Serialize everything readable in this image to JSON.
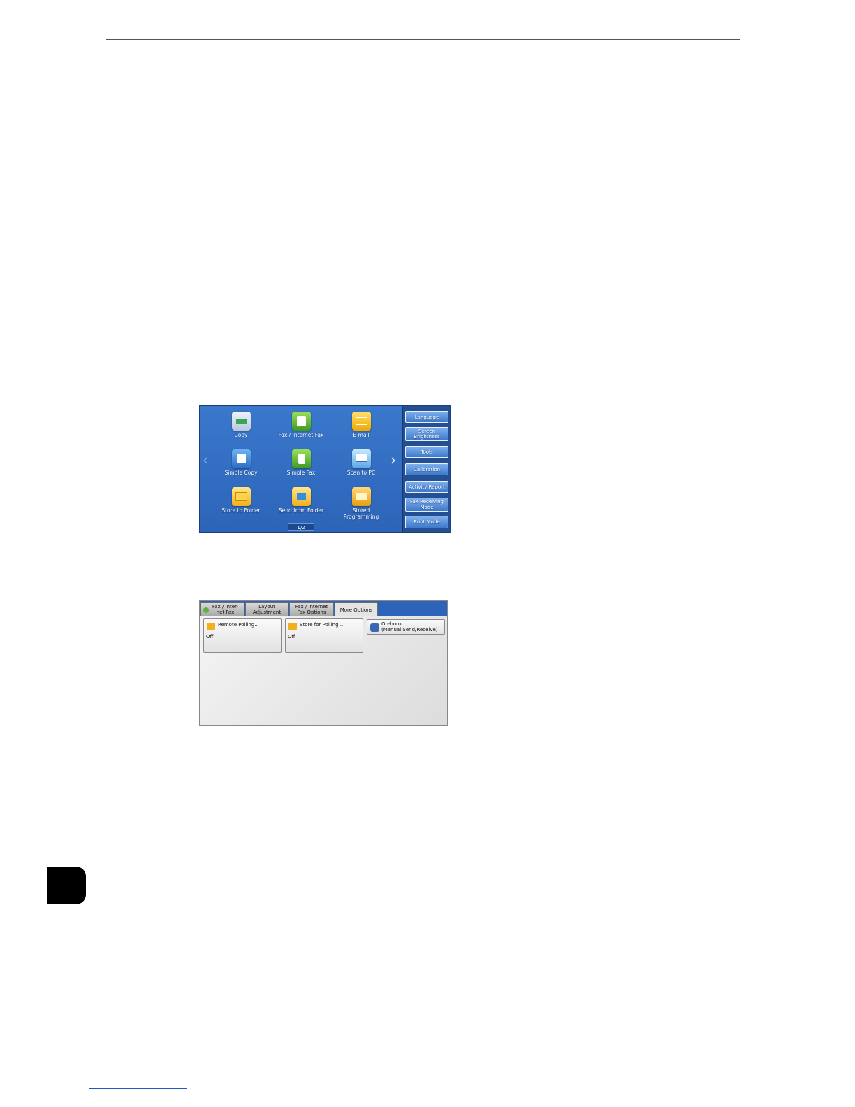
{
  "home": {
    "services": [
      {
        "label": "Copy",
        "icon": "copy-icon"
      },
      {
        "label": "Fax / Internet Fax",
        "icon": "fax-icon"
      },
      {
        "label": "E-mail",
        "icon": "email-icon"
      },
      {
        "label": "Simple Copy",
        "icon": "simple-copy-icon"
      },
      {
        "label": "Simple Fax",
        "icon": "simple-fax-icon"
      },
      {
        "label": "Scan to PC",
        "icon": "scan-to-pc-icon"
      },
      {
        "label": "Store to Folder",
        "icon": "folder-icon"
      },
      {
        "label": "Send from Folder",
        "icon": "send-from-folder-icon"
      },
      {
        "label": "Stored\nProgramming",
        "icon": "stored-programming-icon"
      }
    ],
    "page_indicator": "1/2",
    "side_buttons": [
      "Language",
      "Screen\nBrightness",
      "Tools",
      "Calibration",
      "Activity Report",
      "Fax Receiving\nMode",
      "Print Mode"
    ]
  },
  "more_options": {
    "tabs": [
      "Fax / Inter-\nnet Fax",
      "Layout\nAdjustment",
      "Fax / Internet\nFax Options",
      "More Options"
    ],
    "active_tab": "More Options",
    "options": [
      {
        "label": "Remote Polling...",
        "value": "Off"
      },
      {
        "label": "Store for Polling...",
        "value": "Off"
      },
      {
        "label": "On-hook\n(Manual Send/Receive)"
      }
    ]
  }
}
